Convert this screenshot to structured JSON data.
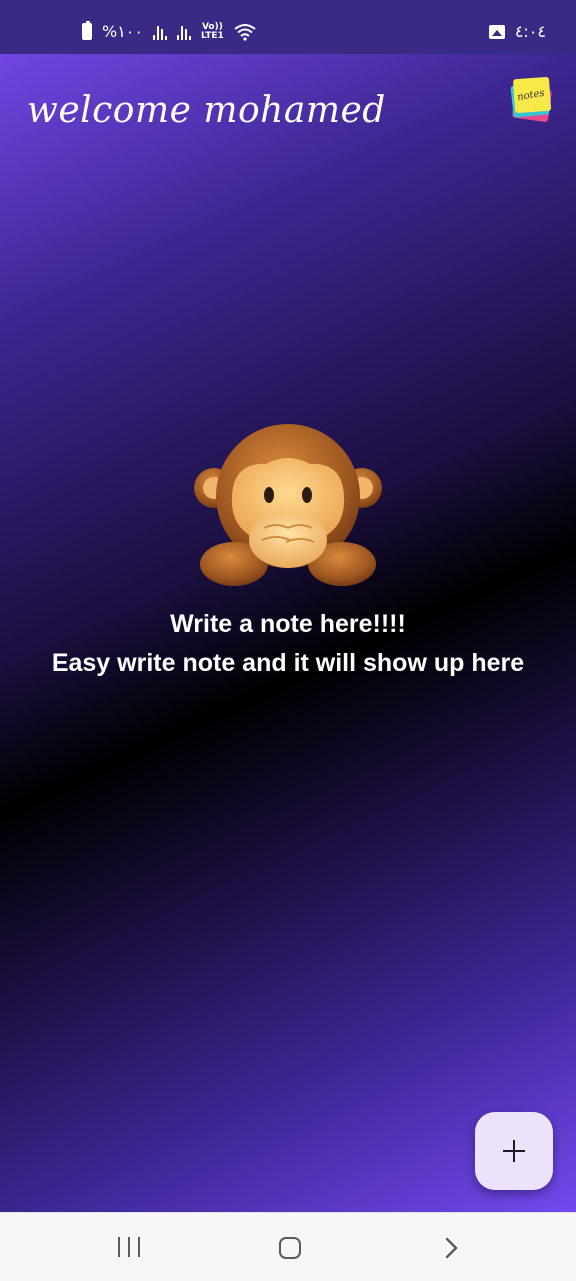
{
  "status_bar": {
    "battery": "%١٠٠",
    "volte_top": "Vo))",
    "volte_bottom": "LTE1",
    "time": "٤:٠٤",
    "icons": [
      "battery-icon",
      "signal-icon",
      "signal-icon",
      "volte-icon",
      "wifi-icon",
      "gallery-icon"
    ]
  },
  "header": {
    "welcome_text": "welcome mohamed",
    "logo_icon": "sticky-notes-logo-icon",
    "logo_text": "notes"
  },
  "empty_state": {
    "illustration": "speak-no-evil-monkey-icon",
    "title": "Write a note here!!!!",
    "subtitle": "Easy write note and it will show up here"
  },
  "fab": {
    "icon": "plus-icon",
    "label": "+"
  },
  "nav_bar": {
    "items": [
      "recent-apps-icon",
      "home-icon",
      "back-icon"
    ]
  },
  "colors": {
    "gradient_top": "#7b4cf1",
    "gradient_middle": "#000000",
    "gradient_bottom": "#7448ee",
    "fab_background": "#ece3fb"
  }
}
